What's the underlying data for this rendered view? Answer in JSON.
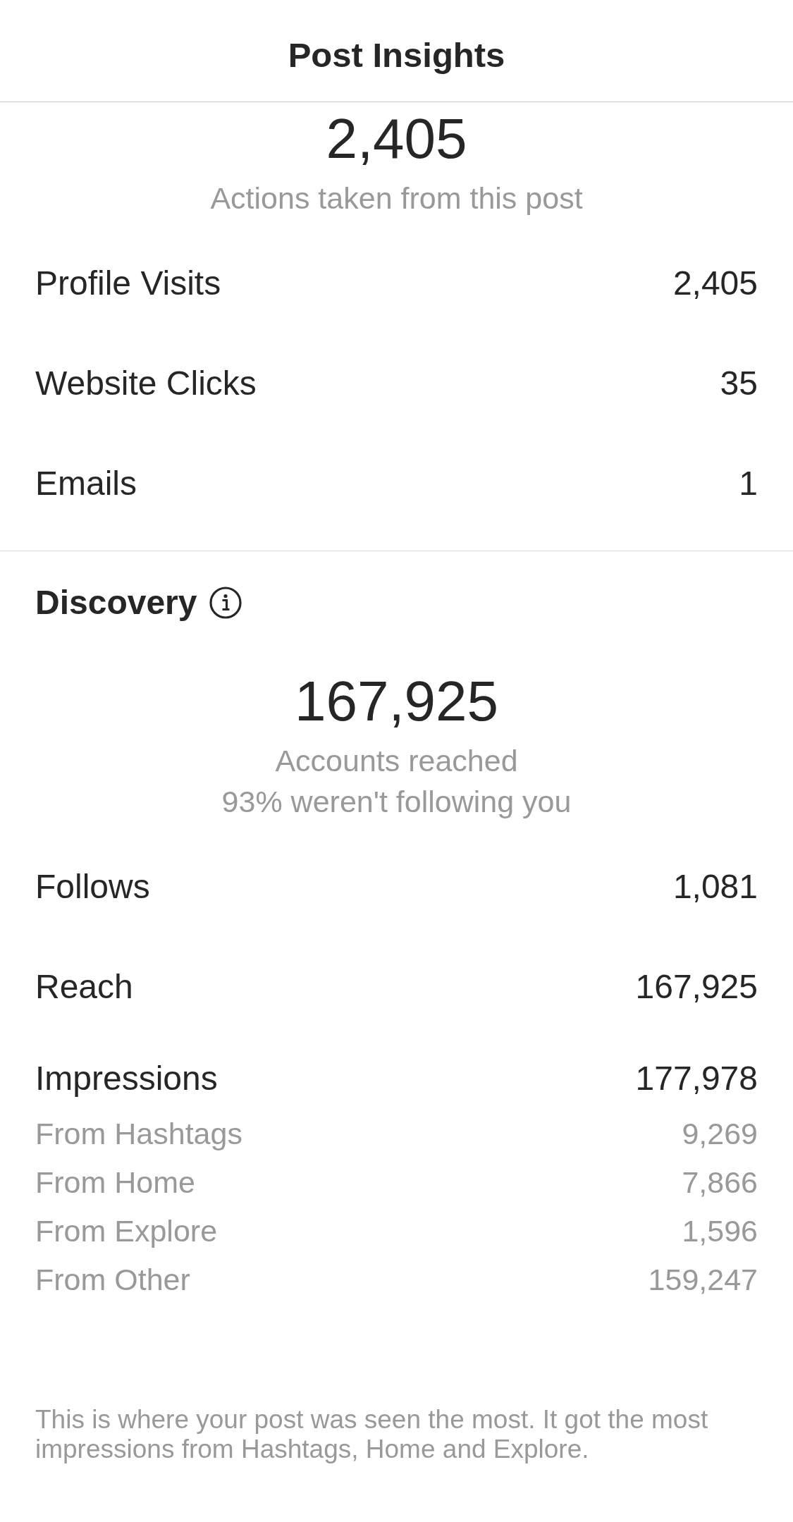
{
  "header": {
    "title": "Post Insights"
  },
  "actions": {
    "total": "2,405",
    "caption": "Actions taken from this post",
    "rows": [
      {
        "label": "Profile Visits",
        "value": "2,405"
      },
      {
        "label": "Website Clicks",
        "value": "35"
      },
      {
        "label": "Emails",
        "value": "1"
      }
    ]
  },
  "discovery": {
    "heading": "Discovery",
    "total": "167,925",
    "captions": [
      "Accounts reached",
      "93% weren't following you"
    ],
    "rows": [
      {
        "label": "Follows",
        "value": "1,081"
      },
      {
        "label": "Reach",
        "value": "167,925"
      },
      {
        "label": "Impressions",
        "value": "177,978",
        "breakdown": [
          {
            "label": "From Hashtags",
            "value": "9,269"
          },
          {
            "label": "From Home",
            "value": "7,866"
          },
          {
            "label": "From Explore",
            "value": "1,596"
          },
          {
            "label": "From Other",
            "value": "159,247"
          }
        ]
      }
    ]
  },
  "footnote": "This is where your post was seen the most. It got the most impressions from Hashtags, Home and Explore."
}
